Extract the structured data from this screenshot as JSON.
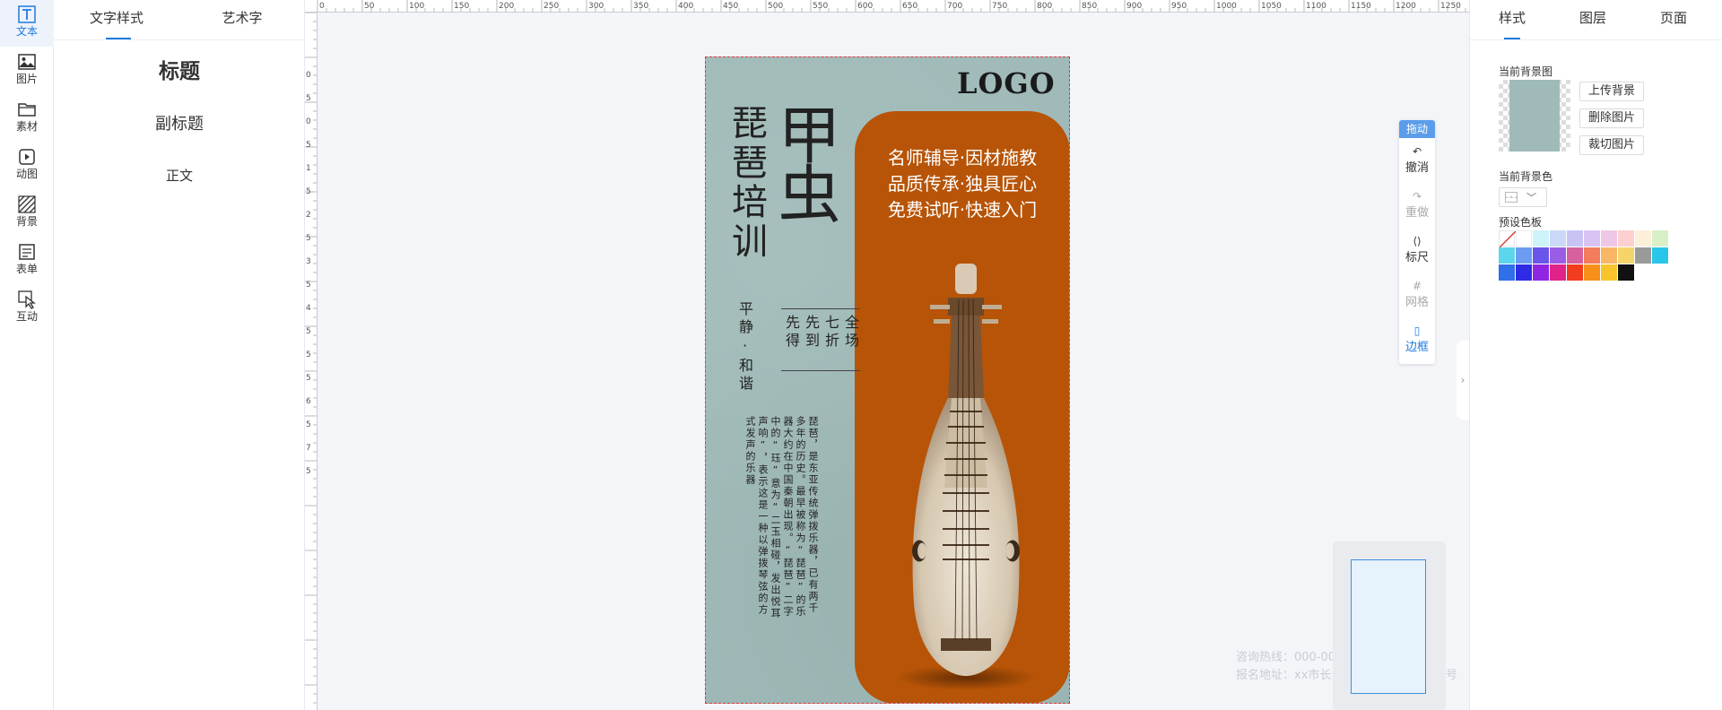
{
  "rail": {
    "items": [
      {
        "label": "文本",
        "icon": "text-icon"
      },
      {
        "label": "图片",
        "icon": "image-icon"
      },
      {
        "label": "素材",
        "icon": "folder-icon"
      },
      {
        "label": "动图",
        "icon": "play-icon"
      },
      {
        "label": "背景",
        "icon": "stripes-icon"
      },
      {
        "label": "表单",
        "icon": "form-icon"
      },
      {
        "label": "互动",
        "icon": "pointer-icon"
      }
    ]
  },
  "left_panel": {
    "tabs": [
      "文字样式",
      "艺术字"
    ],
    "styles": {
      "title": "标题",
      "subtitle": "副标题",
      "body": "正文"
    }
  },
  "ruler": {
    "top_ticks": [
      "0",
      "50",
      "100",
      "150",
      "200",
      "250",
      "300",
      "350",
      "400",
      "450",
      "500",
      "550",
      "600",
      "650",
      "700",
      "750",
      "800",
      "850",
      "900",
      "950",
      "1000",
      "1050",
      "1100",
      "1150",
      "1200",
      "1250"
    ],
    "left_ticks": [
      "0",
      "5",
      "0",
      "5",
      "1",
      "5",
      "2",
      "5",
      "3",
      "5",
      "4",
      "5",
      "5",
      "5",
      "6",
      "5",
      "7",
      "5"
    ]
  },
  "poster": {
    "logo": "LOGO",
    "title": "琵琶培训",
    "big": "甲虫",
    "calm": "平静·和谐",
    "promo": "全场七折先到先得",
    "orange_lines": [
      "名师辅导·因材施教",
      "品质传承·独具匠心",
      "免费试听·快速入门"
    ],
    "body": "琵琶，是东亚传统弹拨乐器，已有两千多年的历史。最早被称为“琵琶”的乐器大约在中国秦朝出现。“琵琶”二字中的“珏”意为“二玉相碰，发出悦耳声响”，表示这是一种以弹拨琴弦的方式发声的乐器"
  },
  "float_toolbar": {
    "head": "拖动",
    "items": [
      {
        "glyph": "↶",
        "label": "撤消",
        "state": "normal"
      },
      {
        "glyph": "↷",
        "label": "重做",
        "state": "disabled"
      },
      {
        "glyph": "⟨⟩",
        "label": "标尺",
        "state": "normal"
      },
      {
        "glyph": "#",
        "label": "网格",
        "state": "disabled"
      },
      {
        "glyph": "▯",
        "label": "边框",
        "state": "active"
      }
    ]
  },
  "ghost": {
    "line1": "咨询热线：000-00",
    "line2": "报名地址：xx市长",
    "line2_tail": "号"
  },
  "right_panel": {
    "tabs": [
      "样式",
      "图层",
      "页面"
    ],
    "current_bg_image": "当前背景图",
    "buttons": [
      "上传背景",
      "删除图片",
      "裁切图片"
    ],
    "current_bg_color": "当前背景色",
    "preset_palette": "预设色板",
    "palette": [
      "none",
      "#ffffff",
      "#cdf4fb",
      "#cbd8f7",
      "#c7c4f5",
      "#d8c3f3",
      "#efc7e6",
      "#fbd0cf",
      "#fdf0d9",
      "#d9efc8",
      "#5dd5ec",
      "#6b9cf2",
      "#6a55ea",
      "#9b5de5",
      "#d6619e",
      "#f27c5c",
      "#f9b766",
      "#f5d56a",
      "#9a9a9a",
      "#2ac6e9",
      "#2f6fe8",
      "#2d2be3",
      "#8f25e0",
      "#e0238a",
      "#f23c1e",
      "#f7901a",
      "#f7c52b",
      "#111111"
    ]
  }
}
